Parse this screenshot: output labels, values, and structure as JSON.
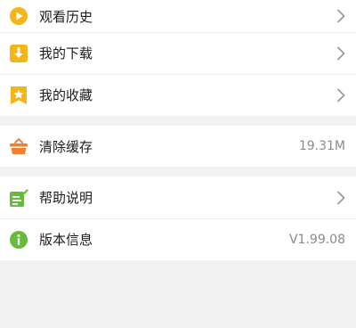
{
  "menu": {
    "history": {
      "label": "观看历史",
      "icon": "play-circle-icon",
      "color": "#f2b619"
    },
    "downloads": {
      "label": "我的下载",
      "icon": "download-icon",
      "color": "#f2b619"
    },
    "favorites": {
      "label": "我的收藏",
      "icon": "star-bookmark-icon",
      "color": "#f2b619"
    },
    "clear_cache": {
      "label": "清除缓存",
      "value": "19.31M",
      "icon": "basket-icon",
      "color": "#f0802f"
    },
    "help": {
      "label": "帮助说明",
      "icon": "help-document-icon",
      "color": "#67bb3a"
    },
    "version": {
      "label": "版本信息",
      "value": "V1.99.08",
      "icon": "info-icon",
      "color": "#67bb3a"
    }
  },
  "colors": {
    "background": "#f1f1f1",
    "row": "#ffffff",
    "text": "#1c1c1c",
    "secondary_text": "#8a8a8a",
    "chevron": "#9a9a9a"
  }
}
